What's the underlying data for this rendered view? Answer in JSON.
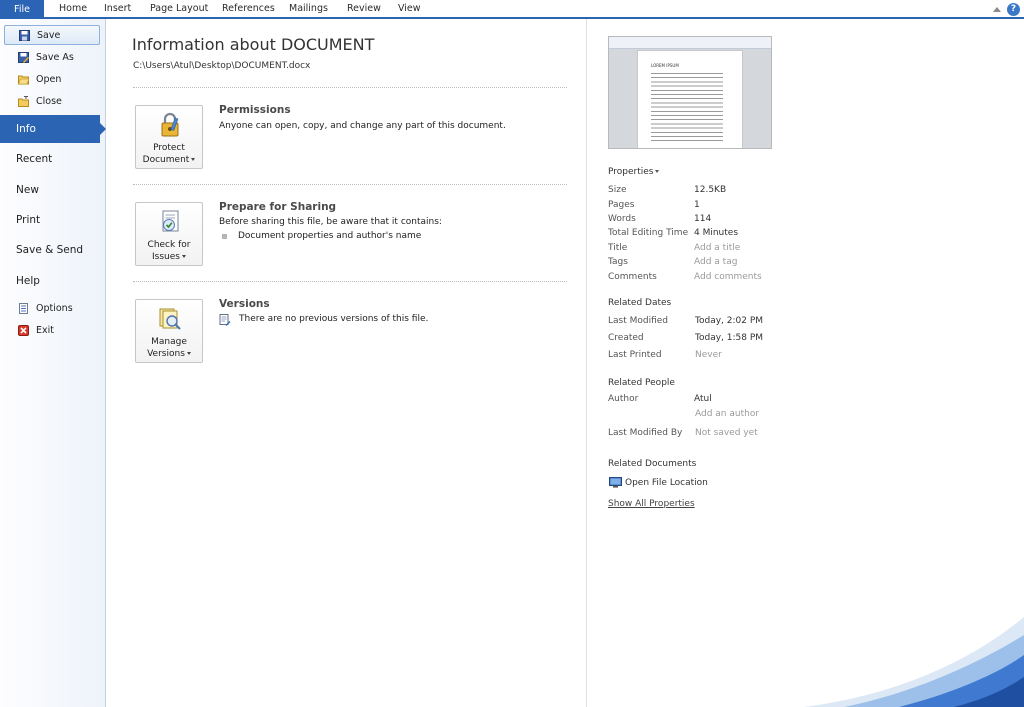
{
  "ribbon": {
    "tabs": [
      "File",
      "Home",
      "Insert",
      "Page Layout",
      "References",
      "Mailings",
      "Review",
      "View"
    ],
    "help_label": "?"
  },
  "nav": {
    "save": "Save",
    "save_as": "Save As",
    "open": "Open",
    "close": "Close",
    "info": "Info",
    "recent": "Recent",
    "new": "New",
    "print": "Print",
    "save_send": "Save & Send",
    "help": "Help",
    "options": "Options",
    "exit": "Exit"
  },
  "info": {
    "title": "Information about DOCUMENT",
    "path": "C:\\Users\\Atul\\Desktop\\DOCUMENT.docx",
    "permissions": {
      "button_line1": "Protect",
      "button_line2": "Document",
      "heading": "Permissions",
      "text": "Anyone can open, copy, and change any part of this document."
    },
    "prepare": {
      "button_line1": "Check for",
      "button_line2": "Issues",
      "heading": "Prepare for Sharing",
      "text": "Before sharing this file, be aware that it contains:",
      "bullet": "Document properties and author's name"
    },
    "versions": {
      "button_line1": "Manage",
      "button_line2": "Versions",
      "heading": "Versions",
      "text": "There are no previous versions of this file."
    }
  },
  "thumbnail": {
    "heading": "LOREM IPSUM"
  },
  "properties": {
    "header": "Properties",
    "rows": [
      {
        "label": "Size",
        "value": "12.5KB"
      },
      {
        "label": "Pages",
        "value": "1"
      },
      {
        "label": "Words",
        "value": "114"
      },
      {
        "label": "Total Editing Time",
        "value": "4 Minutes"
      },
      {
        "label": "Title",
        "value": "Add a title"
      },
      {
        "label": "Tags",
        "value": "Add a tag"
      },
      {
        "label": "Comments",
        "value": "Add comments"
      }
    ]
  },
  "related_dates": {
    "header": "Related Dates",
    "rows": [
      {
        "label": "Last Modified",
        "value": "Today, 2:02 PM"
      },
      {
        "label": "Created",
        "value": "Today, 1:58 PM"
      },
      {
        "label": "Last Printed",
        "value": "Never"
      }
    ]
  },
  "related_people": {
    "header": "Related People",
    "author_label": "Author",
    "author_value": "Atul",
    "add_author": "Add an author",
    "modified_by_label": "Last Modified By",
    "modified_by_value": "Not saved yet"
  },
  "related_documents": {
    "header": "Related Documents",
    "open_location": "Open File Location",
    "show_all": "Show All Properties"
  }
}
